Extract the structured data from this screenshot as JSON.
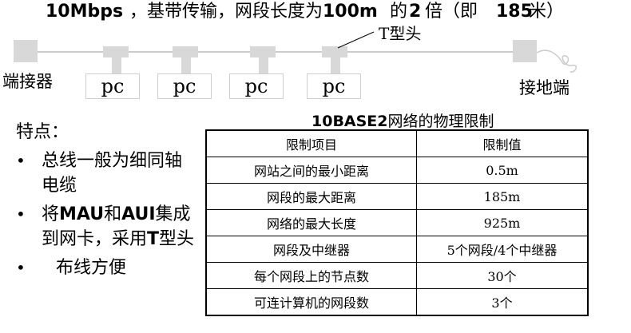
{
  "header": {
    "speed": "10Mbps",
    "text1": "，基带传输，网段长度为",
    "len": "100m",
    "text2": "的",
    "mult": "2",
    "text3": "倍（即",
    "total": "185",
    "text4": "米）"
  },
  "diagram": {
    "t_connector_label": "T型头",
    "terminator_label": "端接器",
    "ground_label": "接地端",
    "pcs": [
      "pc",
      "pc",
      "pc",
      "pc"
    ],
    "colors": {
      "line": "#cccccc",
      "block": "#d8d8d8"
    }
  },
  "features": {
    "heading": "特点：",
    "items": [
      {
        "parts": [
          {
            "text": "总线一般为细同轴电缆",
            "bold": false
          }
        ]
      },
      {
        "parts": [
          {
            "text": "将",
            "bold": false
          },
          {
            "text": "MAU",
            "bold": true
          },
          {
            "text": "和",
            "bold": false
          },
          {
            "text": "AUI",
            "bold": true
          },
          {
            "text": "集成到网卡，采用",
            "bold": false
          },
          {
            "text": "T",
            "bold": true
          },
          {
            "text": "型头",
            "bold": false
          }
        ]
      },
      {
        "parts": [
          {
            "text": "布线方便",
            "bold": false
          }
        ]
      }
    ]
  },
  "table": {
    "title_bold": "10BASE2",
    "title_rest": "网络的物理限制",
    "headers": [
      "限制项目",
      "限制值"
    ],
    "rows": [
      [
        "网站之间的最小距离",
        "0.5m"
      ],
      [
        "网段的最大距离",
        "185m"
      ],
      [
        "网络的最大长度",
        "925m"
      ],
      [
        "网段及中继器",
        "5个网段/4个中继器"
      ],
      [
        "每个网段上的节点数",
        "30个"
      ],
      [
        "可连计算机的网段数",
        "3个"
      ]
    ]
  }
}
